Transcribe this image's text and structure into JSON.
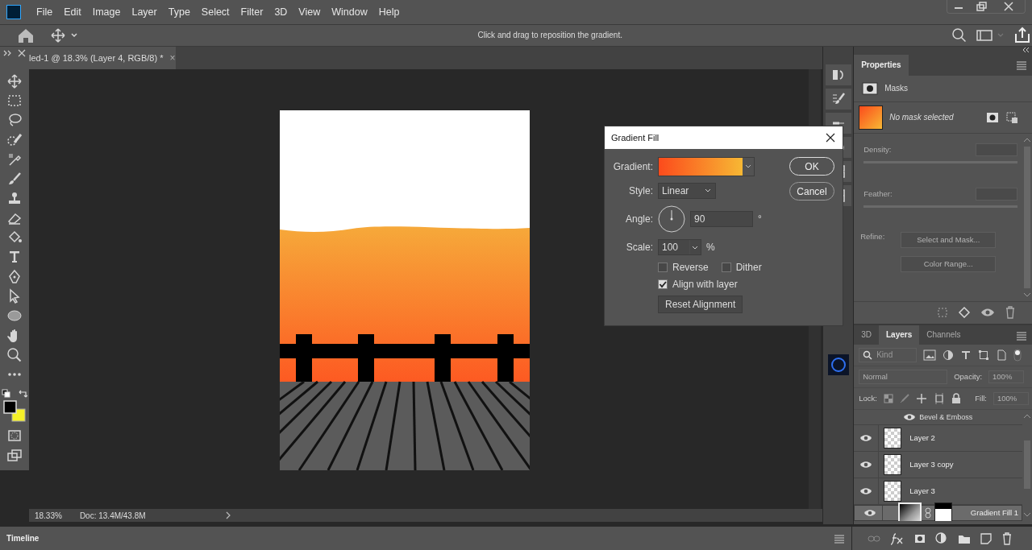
{
  "menu": [
    {
      "label": "File"
    },
    {
      "label": "Edit"
    },
    {
      "label": "Image"
    },
    {
      "label": "Layer"
    },
    {
      "label": "Type"
    },
    {
      "label": "Select"
    },
    {
      "label": "Filter"
    },
    {
      "label": "3D"
    },
    {
      "label": "View"
    },
    {
      "label": "Window"
    },
    {
      "label": "Help"
    }
  ],
  "options_bar": {
    "hint": "Click and drag to reposition the gradient."
  },
  "document": {
    "tab_title": "led-1 @ 18.3% (Layer 4, RGB/8) *",
    "close": "×"
  },
  "dialog": {
    "title": "Gradient Fill",
    "gradient_label": "Gradient:",
    "style_label": "Style:",
    "style": "Linear",
    "angle_label": "Angle:",
    "angle": "90",
    "degree": "°",
    "scale_label": "Scale:",
    "scale": "100",
    "percent": "%",
    "options": [
      {
        "label": "Reverse",
        "checked": false
      },
      {
        "label": "Dither",
        "checked": false
      },
      {
        "label": "Align with layer",
        "checked": true
      }
    ],
    "buttons": [
      "OK",
      "Cancel"
    ],
    "reset_button": "Reset Alignment"
  },
  "properties": {
    "tab": "Properties",
    "section": "Masks",
    "mask_status": "No mask selected",
    "density_label": "Density:",
    "feather_label": "Feather:",
    "refine_label": "Refine:",
    "refine_buttons": [
      "Select and Mask...",
      "Color Range..."
    ]
  },
  "layers_panel": {
    "tabs": [
      {
        "label": "3D",
        "selected": false
      },
      {
        "label": "Layers",
        "selected": true
      },
      {
        "label": "Channels",
        "selected": false
      }
    ],
    "filter": "Kind",
    "blend_mode": "Normal",
    "opacity_label": "Opacity:",
    "opacity": "100%",
    "lock_label": "Lock:",
    "fill_label": "Fill:",
    "fill": "100%",
    "layers": [
      {
        "kind": "effect",
        "name": "Bevel & Emboss",
        "visible": true,
        "selected": false
      },
      {
        "kind": "layer",
        "name": "Layer 2",
        "visible": true,
        "selected": false
      },
      {
        "kind": "layer",
        "name": "Layer 3 copy",
        "visible": true,
        "selected": false
      },
      {
        "kind": "layer",
        "name": "Layer 3",
        "visible": true,
        "selected": false
      },
      {
        "kind": "fill",
        "name": "Gradient Fill 1",
        "visible": true,
        "selected": true
      }
    ]
  },
  "status_bar": {
    "zoom": "18.33%",
    "doc_size": "Doc: 13.4M/43.8M"
  },
  "timeline": {
    "label": "Timeline"
  }
}
